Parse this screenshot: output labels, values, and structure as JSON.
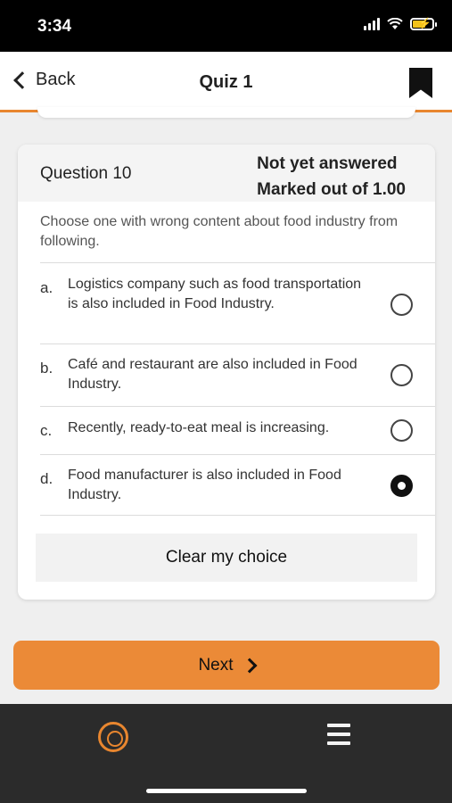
{
  "status_bar": {
    "time": "3:34"
  },
  "nav": {
    "back_label": "Back",
    "title": "Quiz 1"
  },
  "question": {
    "number_label": "Question 10",
    "state_line1": "Not yet answered",
    "state_line2": "Marked out of 1.00",
    "text": "Choose one with wrong content about food industry from following.",
    "answers": [
      {
        "letter": "a.",
        "text": "Logistics company such as food transportation is also included in Food Industry.",
        "selected": false
      },
      {
        "letter": "b.",
        "text": "Café and restaurant are also included in Food Industry.",
        "selected": false
      },
      {
        "letter": "c.",
        "text": "Recently, ready-to-eat meal is increasing.",
        "selected": false
      },
      {
        "letter": "d.",
        "text": "Food manufacturer is also included in Food Industry.",
        "selected": true
      }
    ],
    "clear_label": "Clear my choice"
  },
  "next_label": "Next",
  "colors": {
    "accent": "#e8862f",
    "next_button": "#eb8a37",
    "bottom_bar": "#2b2b2b",
    "battery": "#f2c21b"
  },
  "icons": [
    "signal-icon",
    "wifi-icon",
    "battery-charging-icon",
    "back-chevron-icon",
    "bookmark-icon",
    "next-chevron-icon",
    "logo-icon",
    "menu-icon"
  ]
}
